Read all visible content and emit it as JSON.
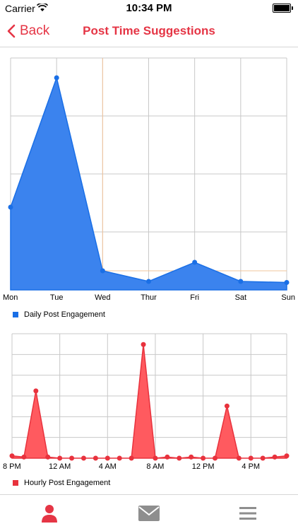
{
  "status_bar": {
    "carrier": "Carrier",
    "time": "10:34 PM"
  },
  "nav": {
    "back_label": "Back",
    "title": "Post Time Suggestions"
  },
  "colors": {
    "accent": "#e53545",
    "daily_fill": "#3b83ee",
    "daily_line": "#1a6fe6",
    "hourly_fill": "#ff5a5f",
    "hourly_line": "#e8323d",
    "grid": "#c8c8c8",
    "highlight": "#f2c49b"
  },
  "chart_data": [
    {
      "type": "area",
      "categories": [
        "Mon",
        "Tue",
        "Wed",
        "Thur",
        "Fri",
        "Sat",
        "Sun"
      ],
      "series": [
        {
          "name": "Daily Post Engagement",
          "values": [
            0.39,
            1.0,
            0.09,
            0.04,
            0.13,
            0.04,
            0.035
          ]
        }
      ],
      "legend": "bottom-left",
      "grid": true
    },
    {
      "type": "area",
      "x_tick_labels": [
        "8 PM",
        "12 AM",
        "4 AM",
        "8 AM",
        "12 PM",
        "4 PM"
      ],
      "series": [
        {
          "name": "Hourly Post Engagement",
          "values": [
            0.02,
            0.01,
            0.58,
            0.01,
            0.0,
            0.0,
            0.0,
            0.0,
            0.0,
            0.0,
            0.0,
            0.98,
            0.0,
            0.01,
            0.0,
            0.01,
            0.0,
            0.0,
            0.45,
            0.0,
            0.0,
            0.0,
            0.01,
            0.02
          ]
        }
      ],
      "legend": "bottom-left",
      "grid": true
    }
  ],
  "tabs": [
    {
      "icon": "person-icon",
      "active": true
    },
    {
      "icon": "envelope-icon",
      "active": false
    },
    {
      "icon": "menu-icon",
      "active": false
    }
  ]
}
